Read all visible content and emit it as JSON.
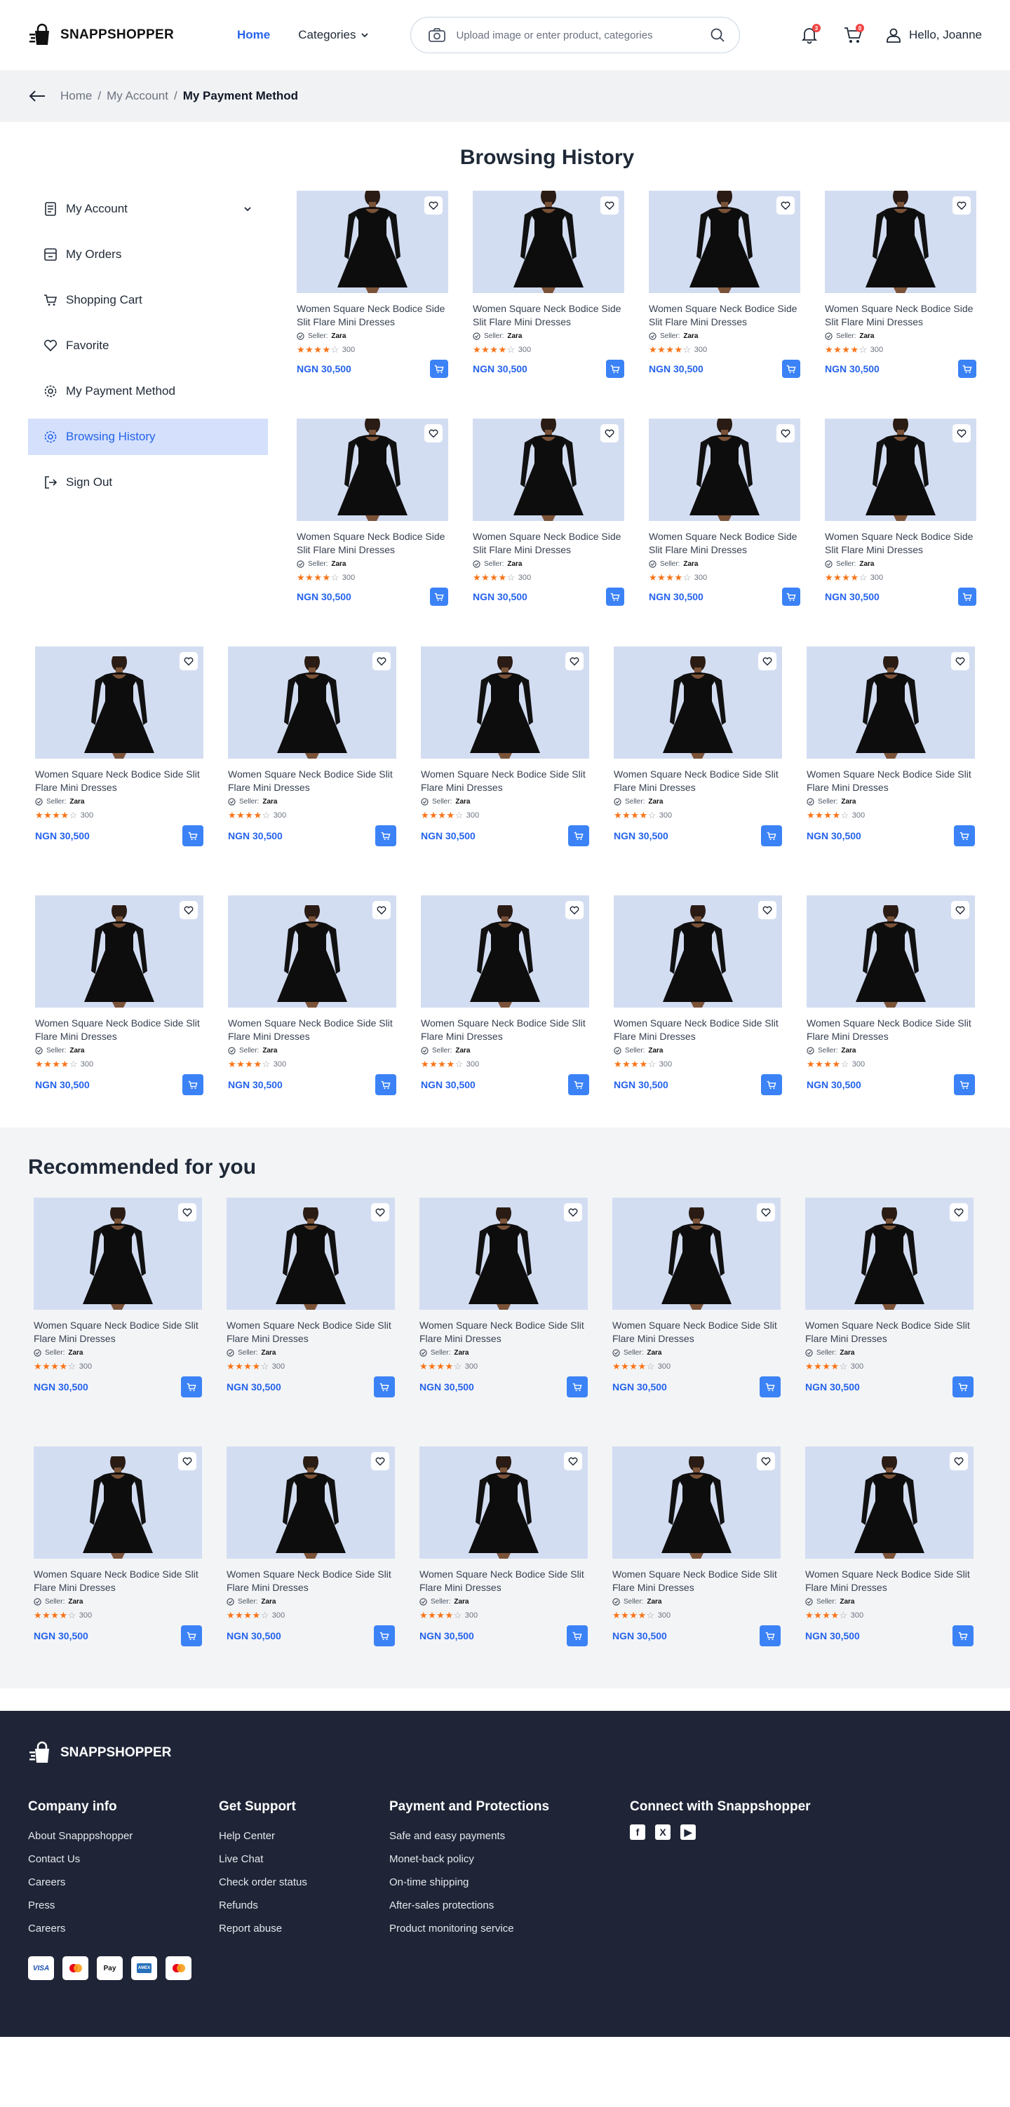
{
  "header": {
    "brand": "SNAPPSHOPPER",
    "nav_home": "Home",
    "nav_categories": "Categories",
    "search_placeholder": "Upload image or enter product, categories",
    "notification_count": "3",
    "cart_count": "0",
    "greeting": "Hello, Joanne"
  },
  "breadcrumb": {
    "home": "Home",
    "account": "My Account",
    "current": "My Payment Method",
    "sep": "/"
  },
  "page_title": "Browsing History",
  "sidebar": {
    "items": [
      {
        "label": "My Account"
      },
      {
        "label": "My Orders"
      },
      {
        "label": "Shopping Cart"
      },
      {
        "label": "Favorite"
      },
      {
        "label": "My Payment Method"
      },
      {
        "label": "Browsing History"
      },
      {
        "label": "Sign Out"
      }
    ]
  },
  "product": {
    "name": "Women Square Neck Bodice Side Slit Flare Mini Dresses",
    "seller_label": "Seller:",
    "seller": "Zara",
    "reviews": "300",
    "rating": 4,
    "price": "NGN 30,500"
  },
  "recommended_title": "Recommended for you",
  "footer": {
    "brand": "SNAPPSHOPPER",
    "company": {
      "title": "Company info",
      "links": [
        "About Snapppshopper",
        "Contact Us",
        "Careers",
        "Press",
        "Careers"
      ]
    },
    "support": {
      "title": "Get Support",
      "links": [
        "Help Center",
        "Live Chat",
        "Check order status",
        "Refunds",
        "Report abuse"
      ]
    },
    "payment": {
      "title": "Payment and Protections",
      "links": [
        "Safe and easy payments",
        "Monet-back policy",
        "On-time shipping",
        "After-sales protections",
        "Product monitoring service"
      ]
    },
    "connect": {
      "title": "Connect with Snappshopper"
    },
    "payment_methods": [
      "VISA",
      "Mastercard",
      "Apple Pay",
      "American Express",
      "Mastercard"
    ]
  },
  "colors": {
    "accent": "#2563eb",
    "active_bg": "#d4e0fc",
    "card_bg": "#d3ddf2",
    "footer_bg": "#1f2537",
    "star": "#f97316"
  }
}
